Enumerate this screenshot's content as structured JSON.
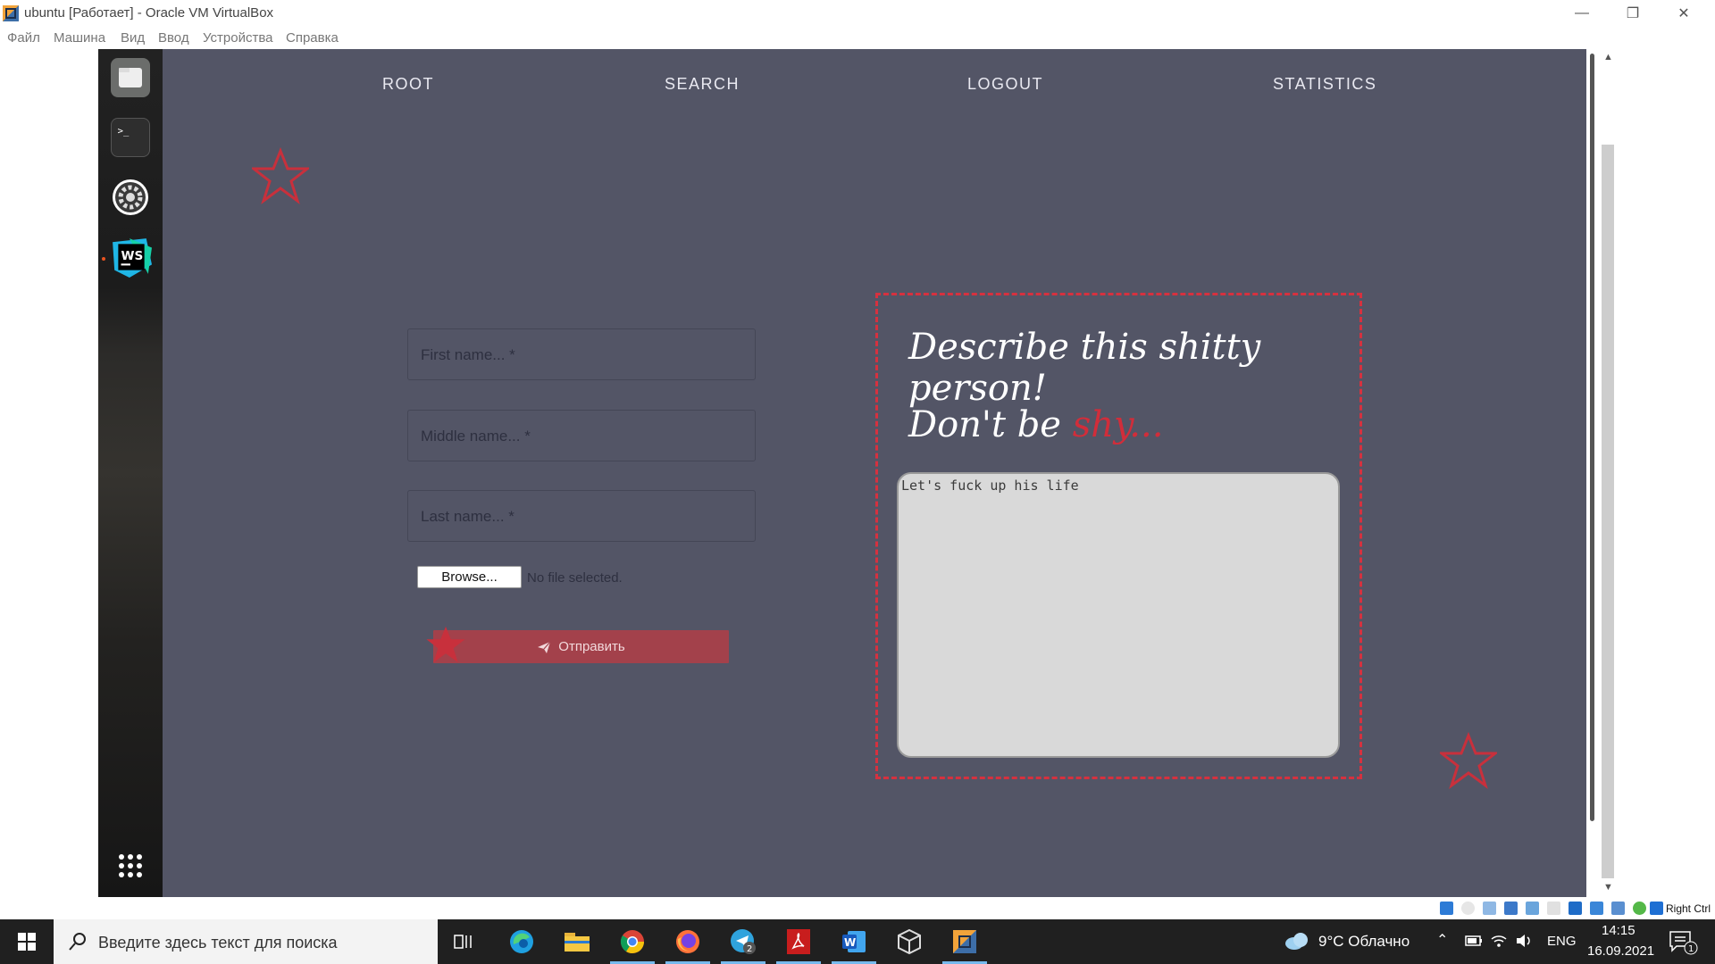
{
  "window": {
    "title": "ubuntu [Работает] - Oracle VM VirtualBox",
    "menu": [
      "Файл",
      "Машина",
      "Вид",
      "Ввод",
      "Устройства",
      "Справка"
    ]
  },
  "dock": {
    "icons": [
      "files-icon",
      "terminal-icon",
      "settings-icon",
      "webstorm-icon",
      "app-grid-icon"
    ]
  },
  "nav": {
    "links": [
      "ROOT",
      "SEARCH",
      "LOGOUT",
      "STATISTICS"
    ]
  },
  "form": {
    "first_name_placeholder": "First name... *",
    "middle_name_placeholder": "Middle name... *",
    "last_name_placeholder": "Last name... *",
    "browse_label": "Browse...",
    "file_status": "No file selected.",
    "submit_label": "Отправить"
  },
  "description": {
    "heading": "Describe this shitty person!",
    "subheading_prefix": "Don't be ",
    "subheading_accent": "shy...",
    "textarea_value": "Let's fuck up his life"
  },
  "status_bar": {
    "host_key": "Right Ctrl"
  },
  "taskbar": {
    "search_placeholder": "Введите здесь текст для поиска",
    "weather": "9°C Облачно",
    "language": "ENG",
    "time": "14:15",
    "date": "16.09.2021",
    "notification_count": "1",
    "telegram_badge": "2"
  },
  "colors": {
    "page_bg": "#535566",
    "accent_red": "#d6313f",
    "submit_bg": "#a3414b",
    "taskbar_bg": "#202020"
  }
}
